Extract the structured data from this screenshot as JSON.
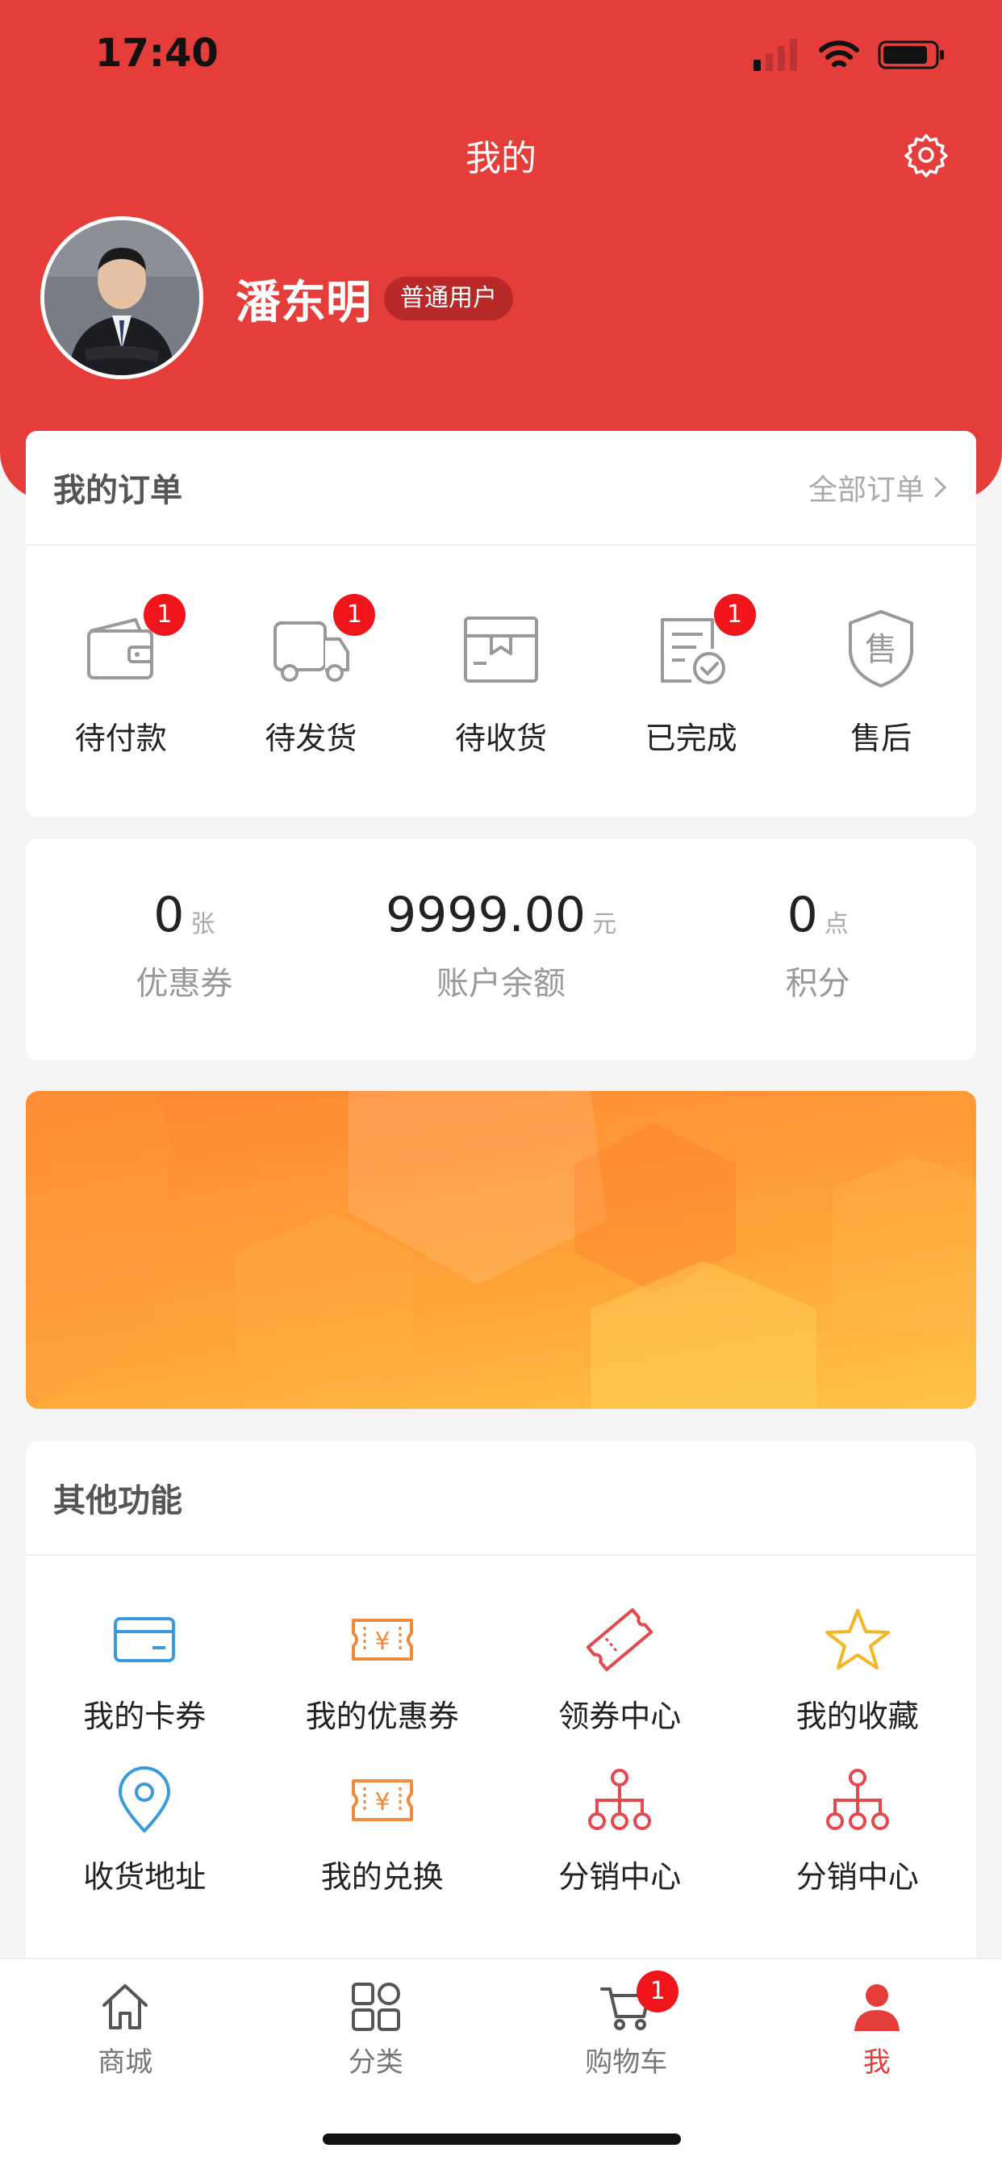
{
  "status_bar": {
    "time": "17:40"
  },
  "nav": {
    "title": "我的"
  },
  "user": {
    "name": "潘东明",
    "badge": "普通用户"
  },
  "orders": {
    "title": "我的订单",
    "all_label": "全部订单",
    "items": [
      {
        "label": "待付款",
        "icon": "wallet-icon",
        "badge": "1"
      },
      {
        "label": "待发货",
        "icon": "truck-icon",
        "badge": "1"
      },
      {
        "label": "待收货",
        "icon": "package-icon",
        "badge": ""
      },
      {
        "label": "已完成",
        "icon": "completed-doc-icon",
        "badge": "1"
      },
      {
        "label": "售后",
        "icon": "after-sale-shield-icon",
        "badge": ""
      }
    ]
  },
  "stats": [
    {
      "value": "0",
      "unit": "张",
      "label": "优惠券"
    },
    {
      "value": "9999.00",
      "unit": "元",
      "label": "账户余额"
    },
    {
      "value": "0",
      "unit": "点",
      "label": "积分"
    }
  ],
  "functions": {
    "title": "其他功能",
    "items": [
      {
        "label": "我的卡券",
        "icon": "card-icon",
        "color": "#3a9bdc"
      },
      {
        "label": "我的优惠券",
        "icon": "coupon-icon",
        "color": "#f08a3c"
      },
      {
        "label": "领券中心",
        "icon": "ticket-icon",
        "color": "#e5484d"
      },
      {
        "label": "我的收藏",
        "icon": "star-icon",
        "color": "#f5b623"
      },
      {
        "label": "收货地址",
        "icon": "location-pin-icon",
        "color": "#3a9bdc"
      },
      {
        "label": "我的兑换",
        "icon": "exchange-coupon-icon",
        "color": "#f08a3c"
      },
      {
        "label": "分销中心",
        "icon": "distribution-tree-icon",
        "color": "#e5484d"
      },
      {
        "label": "分销中心",
        "icon": "distribution-tree-icon",
        "color": "#e5484d"
      }
    ]
  },
  "tabbar": {
    "items": [
      {
        "label": "商城",
        "icon": "home-icon"
      },
      {
        "label": "分类",
        "icon": "category-grid-icon"
      },
      {
        "label": "购物车",
        "icon": "cart-icon",
        "badge": "1"
      },
      {
        "label": "我",
        "icon": "user-icon",
        "active": true
      }
    ]
  },
  "colors": {
    "primary": "#e53e3a",
    "badge": "#f0141b",
    "banner_start": "#ff8733",
    "banner_end": "#ffc446"
  }
}
